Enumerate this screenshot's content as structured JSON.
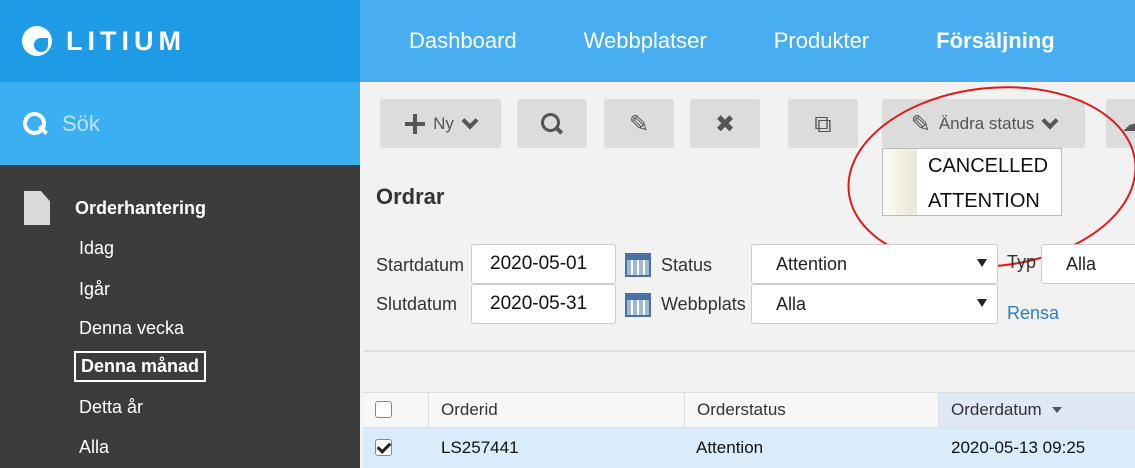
{
  "brand": {
    "name": "LITIUM"
  },
  "topnav": {
    "items": [
      "Dashboard",
      "Webbplatser",
      "Produkter",
      "Försäljning"
    ],
    "active": "Försäljning"
  },
  "search": {
    "placeholder": "Sök"
  },
  "sidebar": {
    "section": "Orderhantering",
    "items": [
      "Idag",
      "Igår",
      "Denna vecka",
      "Denna månad",
      "Detta år",
      "Alla"
    ],
    "selected": "Denna månad"
  },
  "toolbar": {
    "new_label": "Ny",
    "change_status_label": "Ändra status",
    "icons": [
      "plus-icon",
      "search-icon",
      "pencil-icon",
      "close-icon",
      "copy-icon",
      "pencil-icon",
      "cloud-icon"
    ]
  },
  "status_dropdown": {
    "options": [
      "CANCELLED",
      "ATTENTION"
    ]
  },
  "page": {
    "title": "Ordrar"
  },
  "filters": {
    "start_label": "Startdatum",
    "start_value": "2020-05-01",
    "end_label": "Slutdatum",
    "end_value": "2020-05-31",
    "status_label": "Status",
    "status_value": "Attention",
    "site_label": "Webbplats",
    "site_value": "Alla",
    "type_label": "Typ",
    "type_value": "Alla",
    "clear_label": "Rensa"
  },
  "table": {
    "columns": [
      "Orderid",
      "Orderstatus",
      "Orderdatum"
    ],
    "sorted_column": "Orderdatum",
    "rows": [
      {
        "checked": true,
        "orderid": "LS257441",
        "status": "Attention",
        "date": "2020-05-13 09:25"
      }
    ]
  },
  "colors": {
    "brand": "#1e9be6",
    "nav": "#49adf2",
    "search": "#3ab0f3",
    "sidebar": "#3c3c3c",
    "annotation": "#e01818",
    "link": "#2a7fc7"
  }
}
